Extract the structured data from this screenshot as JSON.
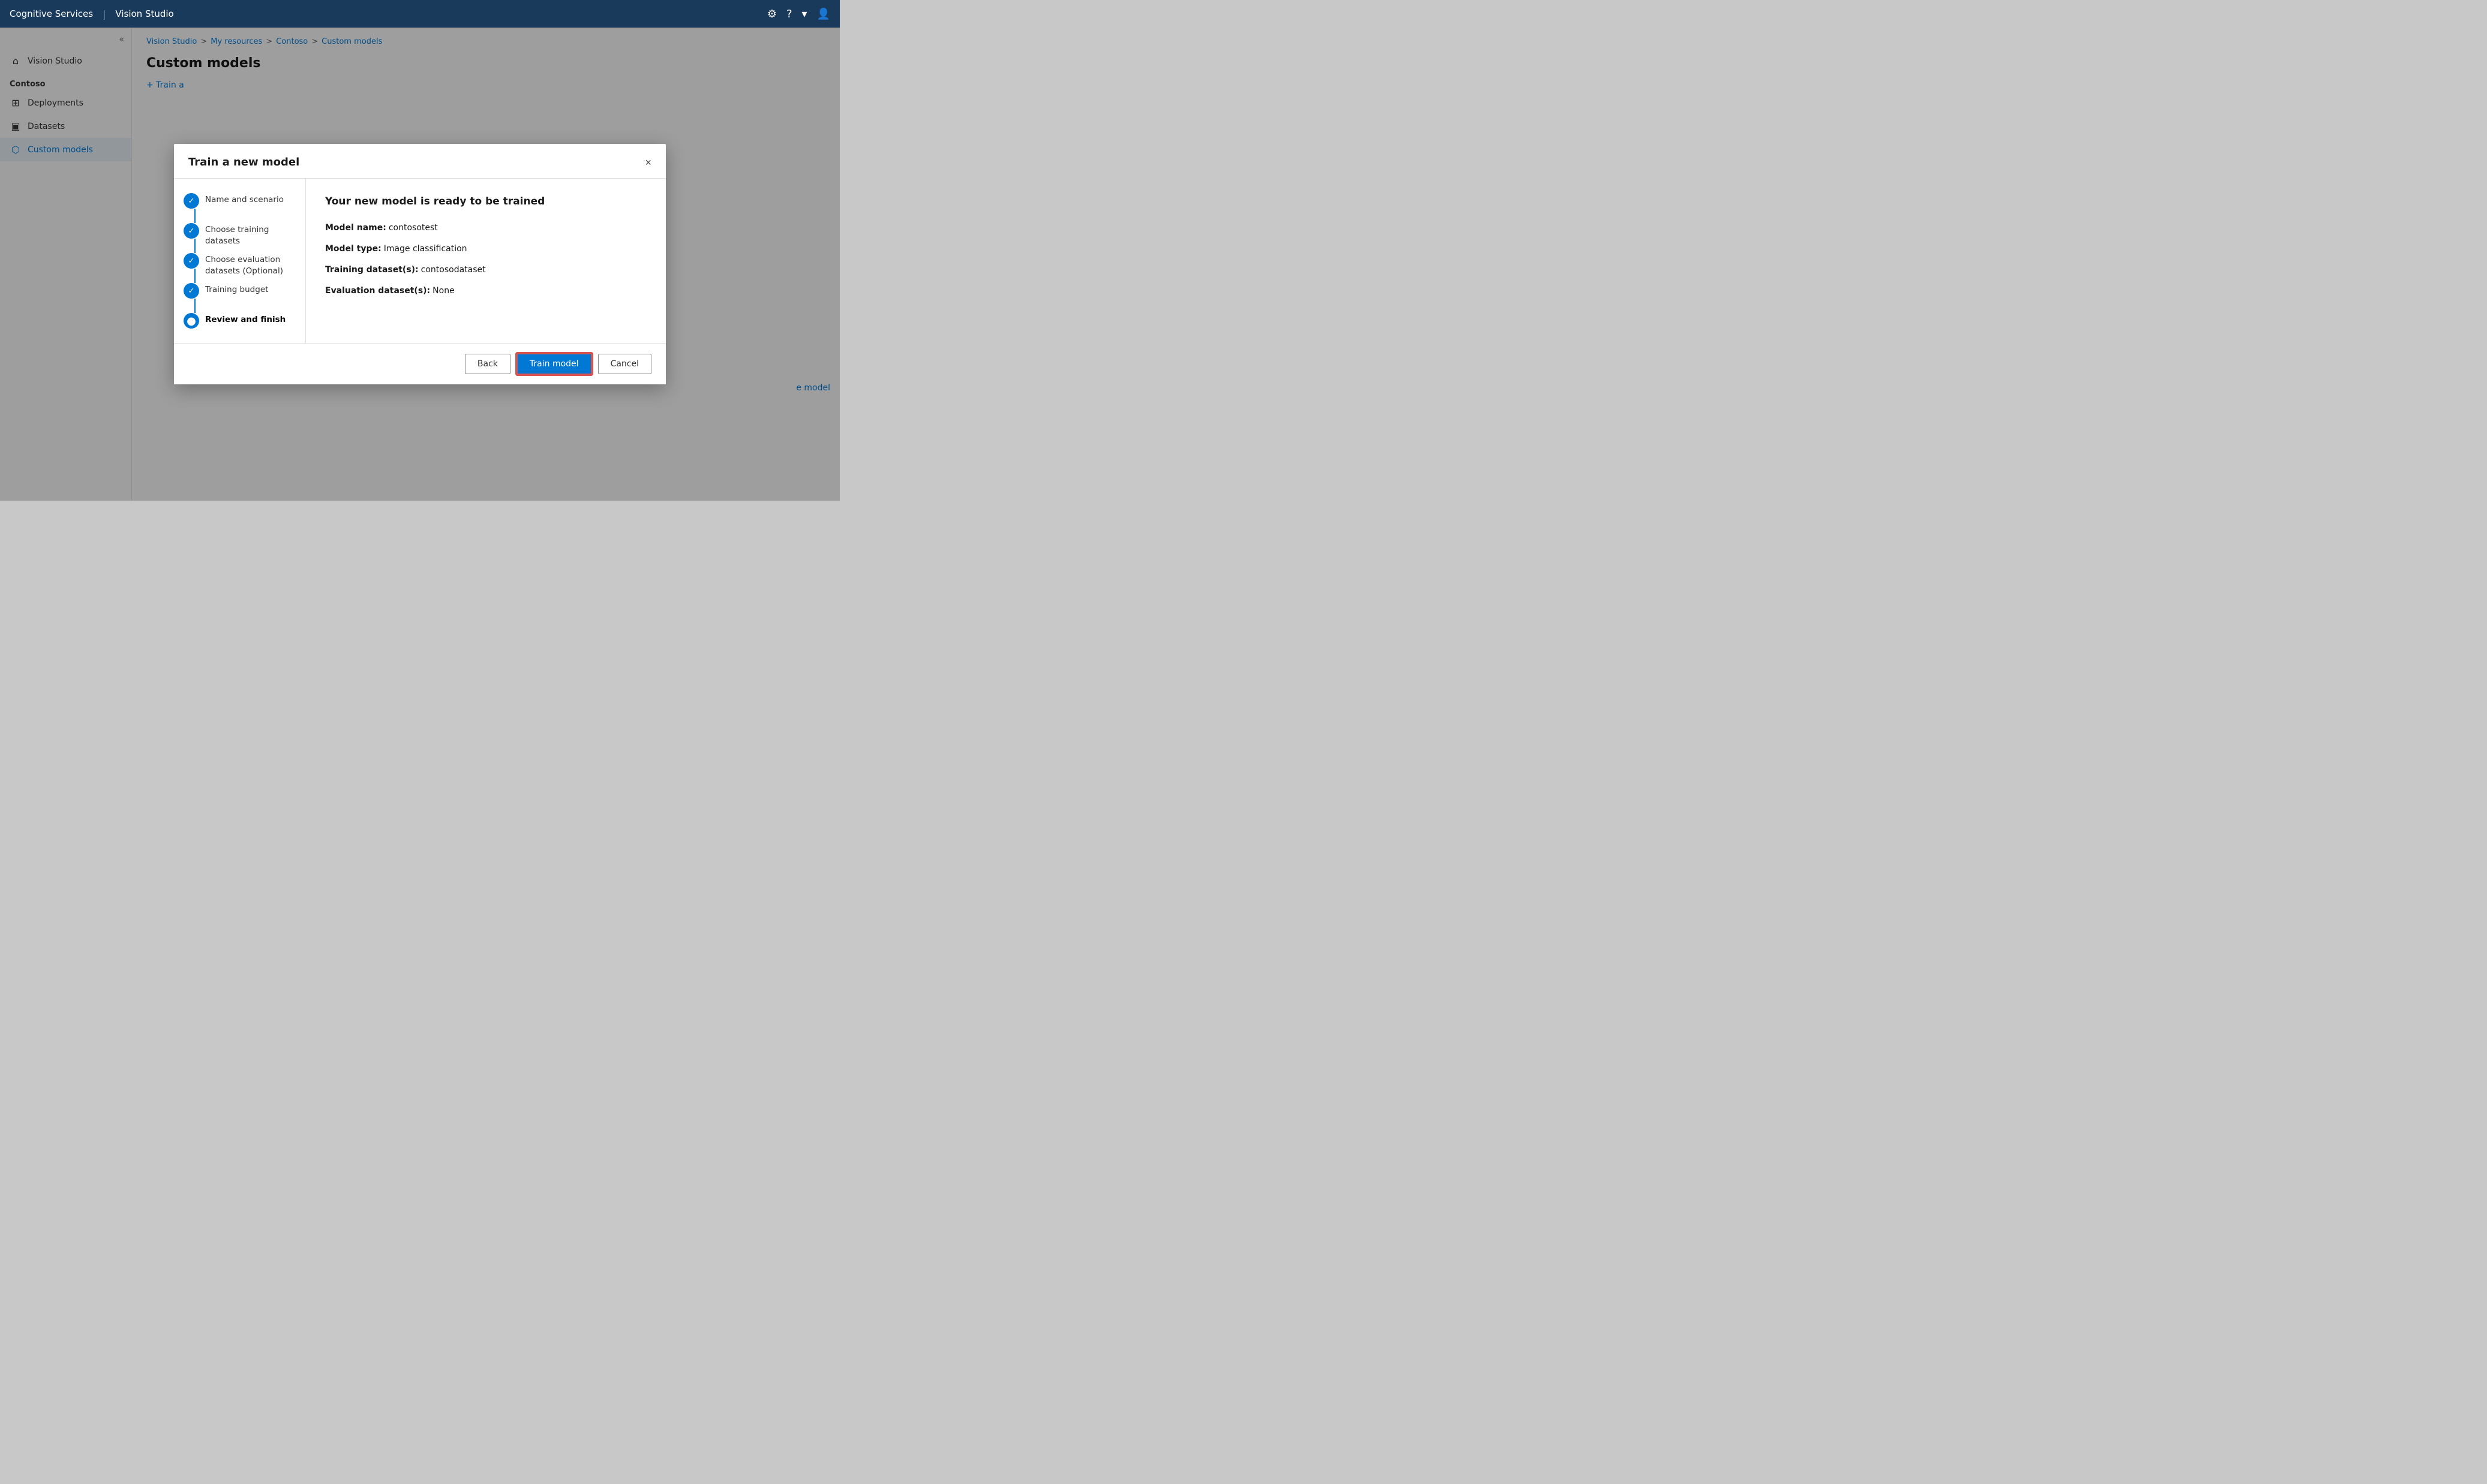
{
  "topNav": {
    "brand": "Cognitive Services",
    "divider": "|",
    "product": "Vision Studio",
    "icons": {
      "settings": "⚙",
      "help": "?",
      "dropdown": "▾",
      "user": "👤"
    }
  },
  "sidebar": {
    "collapseIcon": "«",
    "items": [
      {
        "id": "vision-studio",
        "label": "Vision Studio",
        "icon": "⌂",
        "active": false
      },
      {
        "id": "section-label",
        "label": "Contoso",
        "type": "section"
      },
      {
        "id": "deployments",
        "label": "Deployments",
        "icon": "⊞",
        "active": false
      },
      {
        "id": "datasets",
        "label": "Datasets",
        "icon": "▣",
        "active": false
      },
      {
        "id": "custom-models",
        "label": "Custom models",
        "icon": "⬡",
        "active": true
      }
    ]
  },
  "breadcrumb": {
    "items": [
      {
        "label": "Vision Studio",
        "link": true
      },
      {
        "label": "My resources",
        "link": true
      },
      {
        "label": "Contoso",
        "link": true
      },
      {
        "label": "Custom models",
        "link": true
      }
    ],
    "separator": ">"
  },
  "pageTitle": "Custom models",
  "trainButtonInline": "+ Train a",
  "rightPartialText": "e model",
  "modal": {
    "title": "Train a new model",
    "closeIcon": "×",
    "steps": [
      {
        "id": "name-scenario",
        "label": "Name and scenario",
        "status": "completed",
        "icon": "✓"
      },
      {
        "id": "choose-training",
        "label": "Choose training datasets",
        "status": "completed",
        "icon": "✓"
      },
      {
        "id": "choose-evaluation",
        "label": "Choose evaluation datasets (Optional)",
        "status": "completed",
        "icon": "✓"
      },
      {
        "id": "training-budget",
        "label": "Training budget",
        "status": "completed",
        "icon": "✓"
      },
      {
        "id": "review-finish",
        "label": "Review and finish",
        "status": "active",
        "icon": "●"
      }
    ],
    "review": {
      "heading": "Your new model is ready to be trained",
      "rows": [
        {
          "label": "Model name:",
          "value": "contosotest"
        },
        {
          "label": "Model type:",
          "value": "Image classification"
        },
        {
          "label": "Training dataset(s):",
          "value": "contosodataset"
        },
        {
          "label": "Evaluation dataset(s):",
          "value": "None"
        }
      ]
    },
    "footer": {
      "backLabel": "Back",
      "trainLabel": "Train model",
      "cancelLabel": "Cancel"
    }
  }
}
